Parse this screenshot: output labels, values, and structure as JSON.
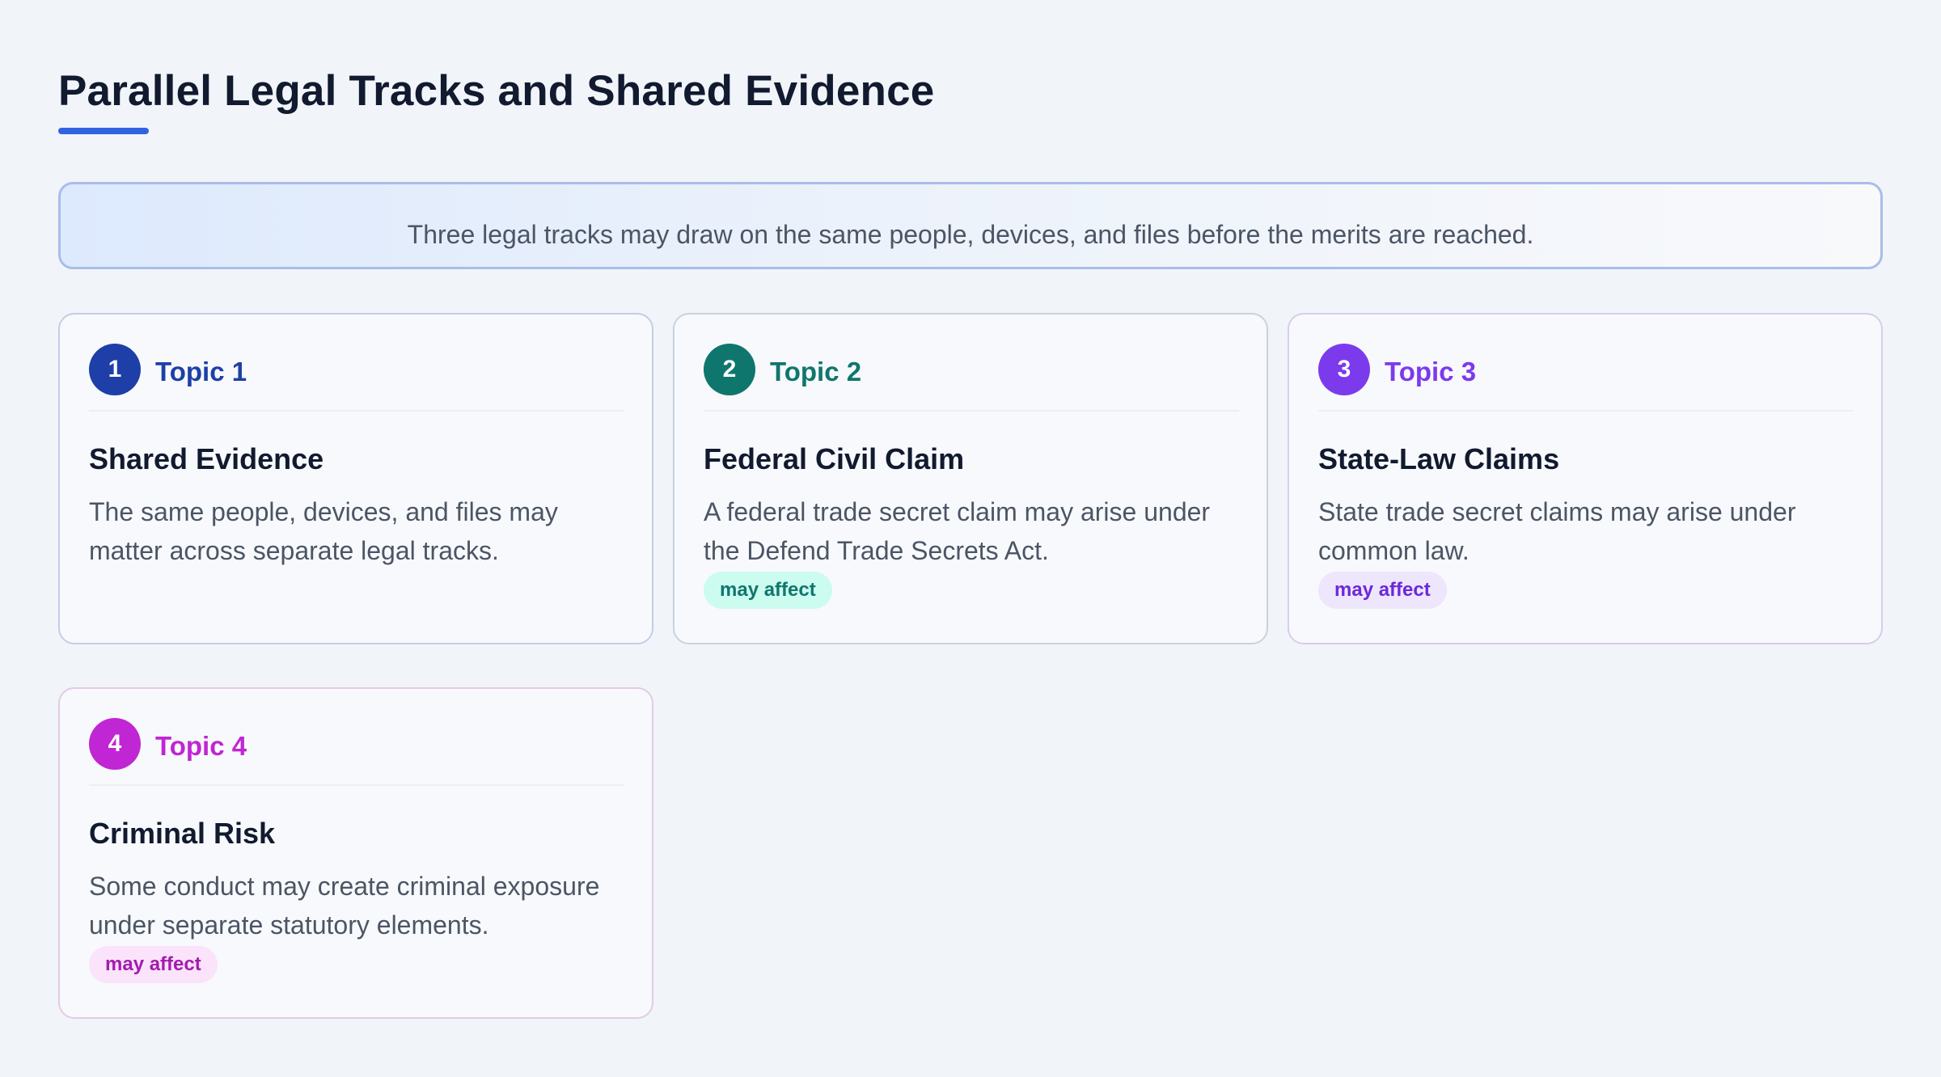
{
  "title": "Parallel Legal Tracks and Shared Evidence",
  "banner": "Three legal tracks may draw on the same people, devices, and files before the merits are reached.",
  "cards": [
    {
      "number": "1",
      "topic": "Topic 1",
      "title": "Shared Evidence",
      "description": "The same people, devices, and files may matter across separate legal tracks.",
      "badge": "",
      "accent_color": "#1e3fa8"
    },
    {
      "number": "2",
      "topic": "Topic 2",
      "title": "Federal Civil Claim",
      "description": "A federal trade secret claim may arise under the Defend Trade Secrets Act.",
      "badge": "may affect",
      "accent_color": "#0f766e",
      "badge_bg": "#ccfbef",
      "badge_color": "#0f766e"
    },
    {
      "number": "3",
      "topic": "Topic 3",
      "title": "State-Law Claims",
      "description": "State trade secret claims may arise under common law.",
      "badge": "may affect",
      "accent_color": "#7c3aed",
      "badge_bg": "#ede6fd",
      "badge_color": "#6d28d9"
    },
    {
      "number": "4",
      "topic": "Topic 4",
      "title": "Criminal Risk",
      "description": "Some conduct may create criminal exposure under separate statutory elements.",
      "badge": "may affect",
      "accent_color": "#c026d3",
      "badge_bg": "#fbe3fb",
      "badge_color": "#a21caf"
    }
  ]
}
